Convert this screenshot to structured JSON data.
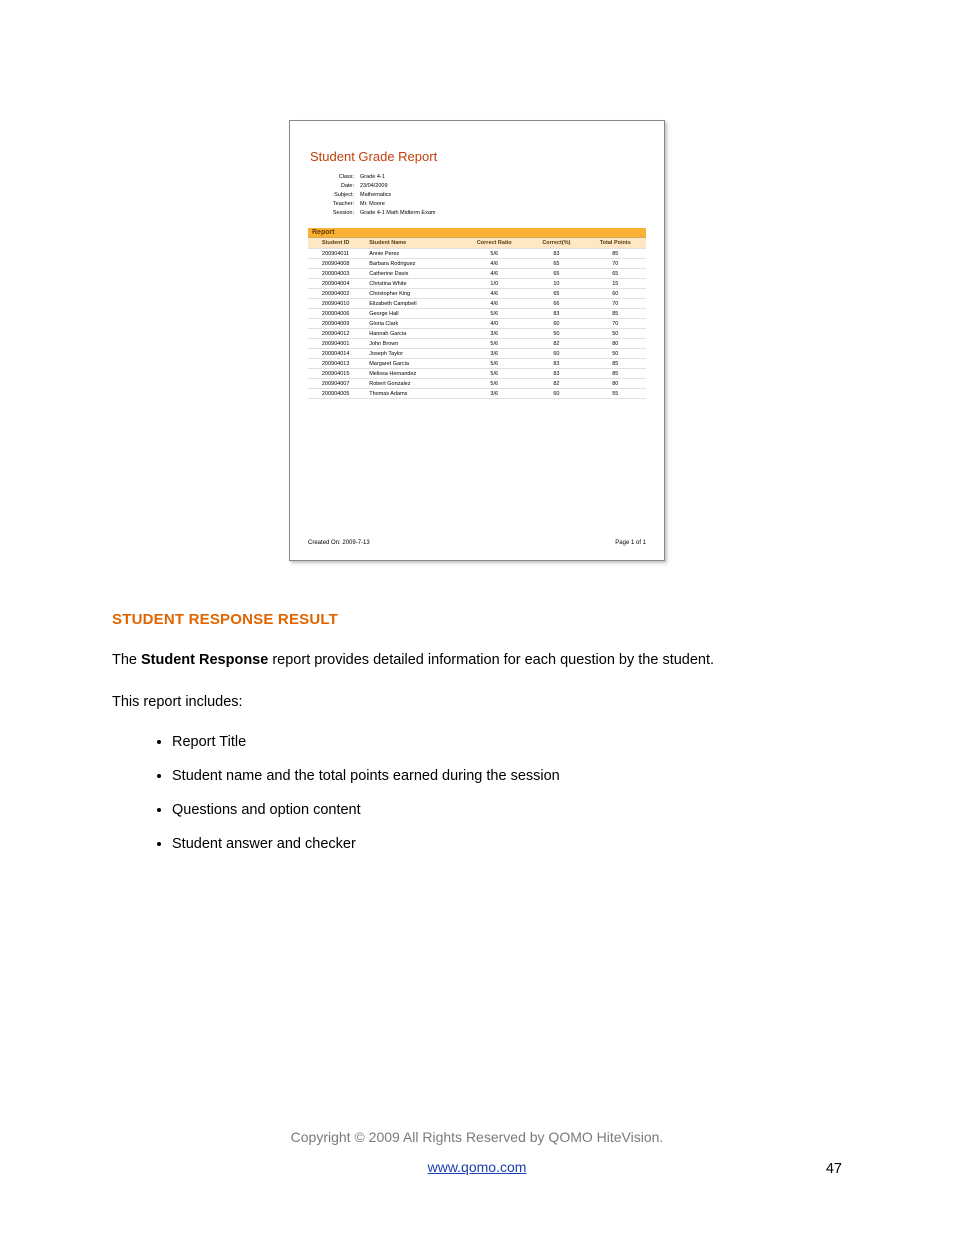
{
  "report": {
    "title": "Student Grade Report",
    "meta": {
      "class_label": "Class:",
      "class_value": "Grade 4-1",
      "date_label": "Date:",
      "date_value": "23/04/2009",
      "subject_label": "Subject:",
      "subject_value": "Mathematics",
      "teacher_label": "Teacher:",
      "teacher_value": "Mr. Moore",
      "session_label": "Session:",
      "session_value": "Grade 4-1 Math Midterm Exam"
    },
    "section_heading": "Report",
    "columns": {
      "id": "Student ID",
      "name": "Student Name",
      "ratio": "Correct Ratio",
      "pct": "Correct(%)",
      "points": "Total Points"
    },
    "rows": [
      {
        "id": "200904011",
        "name": "Annie Perez",
        "ratio": "5/6",
        "pct": "83",
        "points": "85"
      },
      {
        "id": "200904008",
        "name": "Barbara Rodriguez",
        "ratio": "4/6",
        "pct": "65",
        "points": "70"
      },
      {
        "id": "200904003",
        "name": "Catherine Davis",
        "ratio": "4/6",
        "pct": "65",
        "points": "65"
      },
      {
        "id": "200904004",
        "name": "Christina White",
        "ratio": "1/0",
        "pct": "10",
        "points": "15"
      },
      {
        "id": "200904002",
        "name": "Christopher King",
        "ratio": "4/6",
        "pct": "65",
        "points": "60"
      },
      {
        "id": "200904010",
        "name": "Elizabeth Campbell",
        "ratio": "4/6",
        "pct": "66",
        "points": "70"
      },
      {
        "id": "200904006",
        "name": "George Hall",
        "ratio": "5/6",
        "pct": "83",
        "points": "85"
      },
      {
        "id": "200904009",
        "name": "Gloria Clark",
        "ratio": "4/0",
        "pct": "60",
        "points": "70"
      },
      {
        "id": "200904012",
        "name": "Hannah Garcia",
        "ratio": "3/6",
        "pct": "50",
        "points": "50"
      },
      {
        "id": "200904001",
        "name": "John Brown",
        "ratio": "5/6",
        "pct": "82",
        "points": "80"
      },
      {
        "id": "200904014",
        "name": "Joseph Taylor",
        "ratio": "3/6",
        "pct": "60",
        "points": "50"
      },
      {
        "id": "200904013",
        "name": "Margaret Garcia",
        "ratio": "5/6",
        "pct": "83",
        "points": "85"
      },
      {
        "id": "200904015",
        "name": "Melissa Hernandez",
        "ratio": "5/6",
        "pct": "83",
        "points": "85"
      },
      {
        "id": "200904007",
        "name": "Robert Gonzalez",
        "ratio": "5/6",
        "pct": "82",
        "points": "80"
      },
      {
        "id": "200904005",
        "name": "Thomas Adams",
        "ratio": "3/6",
        "pct": "60",
        "points": "55"
      }
    ],
    "created_label": "Created On:",
    "created_value": "2009-7-13",
    "page_label": "Page 1 of 1"
  },
  "doc": {
    "section_title": "STUDENT RESPONSE RESULT",
    "para1_pre": "The ",
    "para1_bold": "Student Response",
    "para1_post": " report provides detailed information for each question by the student.",
    "para2": "This report includes:",
    "bullets": [
      "Report Title",
      "Student name and the total points  earned during the session",
      "Questions and option content",
      "Student answer and checker"
    ],
    "copyright": "Copyright © 2009 All Rights Reserved by QOMO HiteVision.",
    "url": "www.qomo.com",
    "page_number": "47"
  }
}
